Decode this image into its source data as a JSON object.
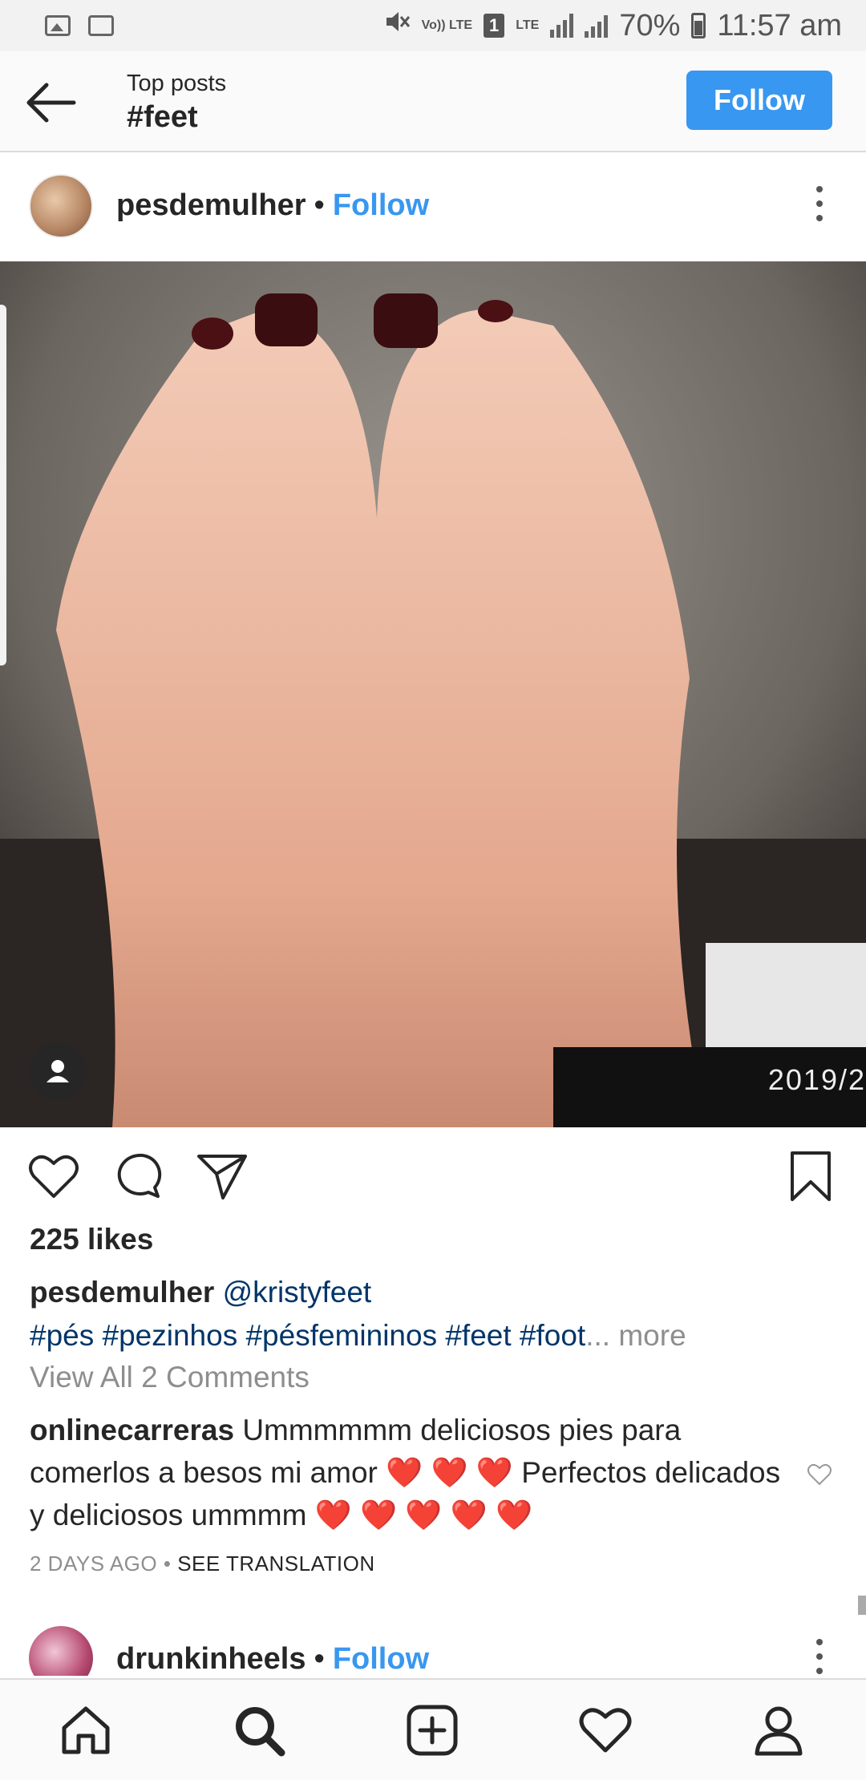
{
  "status_bar": {
    "volte": "Vo)) LTE",
    "sim": "1",
    "lte": "LTE",
    "battery": "70%",
    "time": "11:57 am"
  },
  "header": {
    "subtitle": "Top posts",
    "title": "#feet",
    "follow_label": "Follow"
  },
  "post": {
    "username": "pesdemulher",
    "separator": "•",
    "follow_label": "Follow",
    "photo_date": "2019/2",
    "likes": "225 likes",
    "caption": {
      "username": "pesdemulher",
      "mention": "@kristyfeet",
      "hashtags": "#pés #pezinhos #pésfemininos #feet #foot",
      "ellipsis": "...",
      "more": "more"
    },
    "view_comments": "View All 2 Comments",
    "comment": {
      "username": "onlinecarreras",
      "text_1": "Ummmmmm deliciosos pies para comerlos a besos mi amor",
      "hearts_1": "❤️ ❤️ ❤️",
      "text_2": "Perfectos delicados y deliciosos ummmm",
      "hearts_2": "❤️ ❤️ ❤️ ❤️ ❤️"
    },
    "time_ago": "2 DAYS AGO",
    "meta_separator": "•",
    "see_translation": "SEE TRANSLATION"
  },
  "next_post": {
    "username": "drunkinheels",
    "separator": "•",
    "follow_label": "Follow"
  },
  "icons": {
    "back": "arrow-left-icon",
    "like": "heart-icon",
    "comment": "comment-icon",
    "share": "paper-plane-icon",
    "save": "bookmark-icon",
    "home": "home-icon",
    "search": "search-icon",
    "add": "plus-square-icon",
    "activity": "heart-icon",
    "profile": "person-icon"
  },
  "colors": {
    "accent": "#3897f0",
    "hashtag": "#003569",
    "muted": "#8e8e8e"
  }
}
